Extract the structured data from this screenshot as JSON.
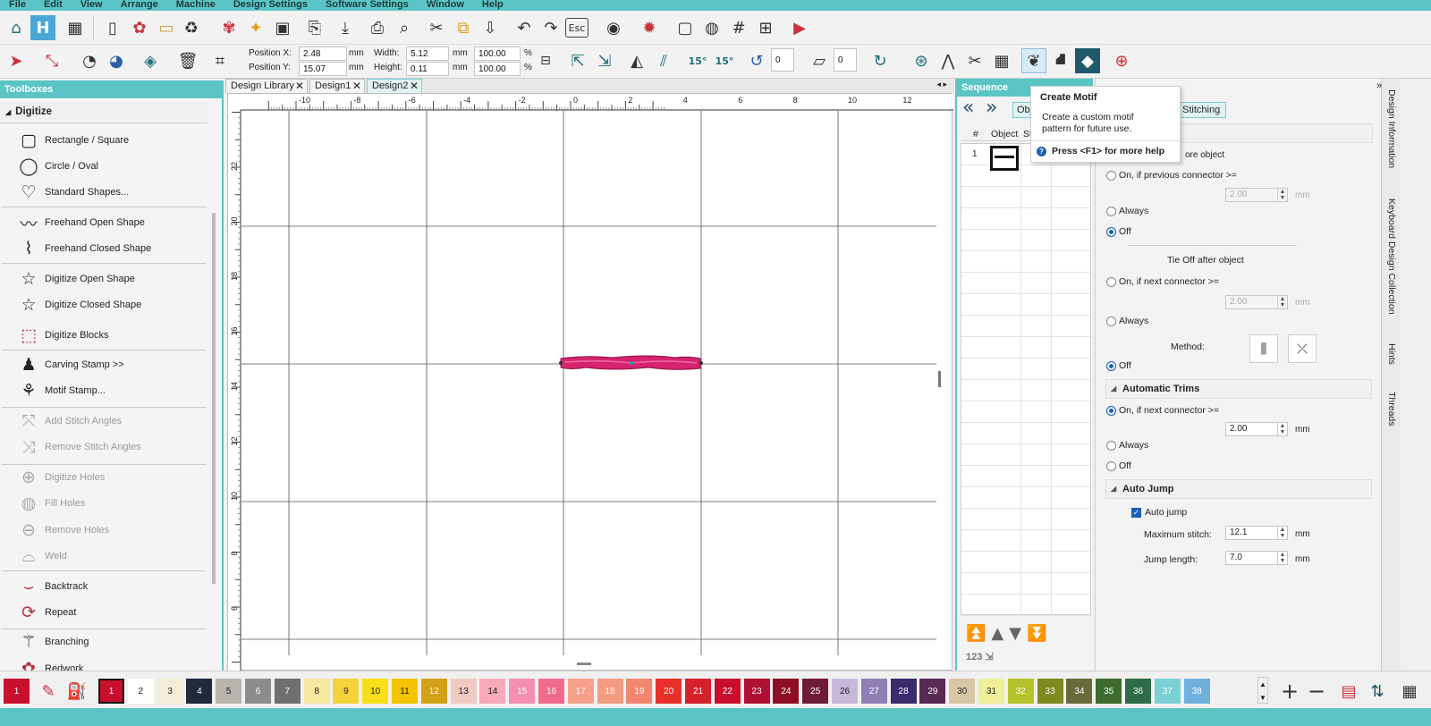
{
  "menu": [
    "File",
    "Edit",
    "View",
    "Arrange",
    "Machine",
    "Design Settings",
    "Software Settings",
    "Window",
    "Help"
  ],
  "toolbar2": {
    "pos_x_label": "Position X:",
    "pos_x": "2.48",
    "pos_y_label": "Position Y:",
    "pos_y": "15.07",
    "width_label": "Width:",
    "width": "5.12",
    "height_label": "Height:",
    "height": "0.11",
    "unit": "mm",
    "pct_w": "100.00",
    "pct_h": "100.00",
    "pct": "%",
    "rot1": "15°",
    "rot2": "15°",
    "angle1": "0",
    "angle2": "0"
  },
  "toolbox": {
    "title": "Toolboxes",
    "section": "Digitize",
    "items": [
      "Rectangle / Square",
      "Circle / Oval",
      "Standard Shapes...",
      "Freehand Open Shape",
      "Freehand Closed Shape",
      "Digitize Open Shape",
      "Digitize Closed Shape",
      "Digitize Blocks",
      "Carving Stamp >>",
      "Motif Stamp...",
      "Add Stitch Angles",
      "Remove Stitch Angles",
      "Digitize Holes",
      "Fill Holes",
      "Remove Holes",
      "Weld",
      "Backtrack",
      "Repeat",
      "Branching",
      "Redwork"
    ]
  },
  "tabs": [
    {
      "label": "Design Library"
    },
    {
      "label": "Design1"
    },
    {
      "label": "Design2"
    }
  ],
  "ruler": {
    "h": [
      "-10",
      "-8",
      "-6",
      "-4",
      "-2",
      "0",
      "2",
      "4",
      "6",
      "8",
      "10",
      "12"
    ],
    "v": [
      "22",
      "20",
      "18",
      "16",
      "14",
      "12",
      "10",
      "8",
      "6"
    ]
  },
  "sequence": {
    "title": "Sequence",
    "tab_obj": "Obj",
    "col_num": "#",
    "col_object": "Object",
    "col_sta": "Sta",
    "row_num": "1",
    "badge": "123"
  },
  "tooltip": {
    "title": "Create Motif",
    "body": "Create a custom motif pattern for future use.",
    "help": "Press <F1> for more help"
  },
  "props": {
    "tab_stitching": "Stitching",
    "tie_before_tail": "ore object",
    "on_prev": "On, if previous connector >=",
    "val1": "2.00",
    "unit": "mm",
    "always": "Always",
    "off": "Off",
    "tie_after": "Tie Off after object",
    "on_next": "On, if next connector >=",
    "val2": "2.00",
    "method": "Method:",
    "auto_trims": "Automatic Trims",
    "trim_on_next": "On, if next connector >=",
    "val3": "2.00",
    "auto_jump_head": "Auto Jump",
    "auto_jump": "Auto jump",
    "max_stitch_label": "Maximum stitch:",
    "max_stitch": "12.1",
    "jump_len_label": "Jump length:",
    "jump_len": "7.0"
  },
  "right_tabs": [
    "Design Information",
    "Keyboard Design Collection",
    "Hints",
    "Threads"
  ],
  "palette": {
    "colors": [
      "#c8102e",
      "#ffffff",
      "#f2ecd9",
      "#1f2a3a",
      "#b8b3ad",
      "#8c8c8c",
      "#6f6f6f",
      "#f6e7a1",
      "#f3d23a",
      "#f7df19",
      "#f5c400",
      "#d4a017",
      "#f0c9c4",
      "#f7a9b8",
      "#f48fb1",
      "#f06a8e",
      "#f7a08c",
      "#f49b83",
      "#f2876d",
      "#e8302b",
      "#d8202b",
      "#c8102e",
      "#b01031",
      "#8e0d24",
      "#6e1c3a",
      "#c7b8d9",
      "#8f7fb5",
      "#3a2a6e",
      "#5a2a55",
      "#d8c7a6",
      "#eef09a",
      "#b5c22a",
      "#7d8a1f",
      "#6a6b3a",
      "#3c6b2f",
      "#2f6b46",
      "#7ad0d3",
      "#6fb0dd"
    ],
    "labels": [
      "1",
      "2",
      "3",
      "4",
      "5",
      "6",
      "7",
      "8",
      "9",
      "10",
      "11",
      "12",
      "13",
      "14",
      "15",
      "16",
      "17",
      "18",
      "19",
      "20",
      "21",
      "22",
      "23",
      "24",
      "25",
      "26",
      "27",
      "28",
      "29",
      "30",
      "31",
      "32",
      "33",
      "34",
      "35",
      "36",
      "37",
      "38"
    ],
    "current": "1"
  }
}
